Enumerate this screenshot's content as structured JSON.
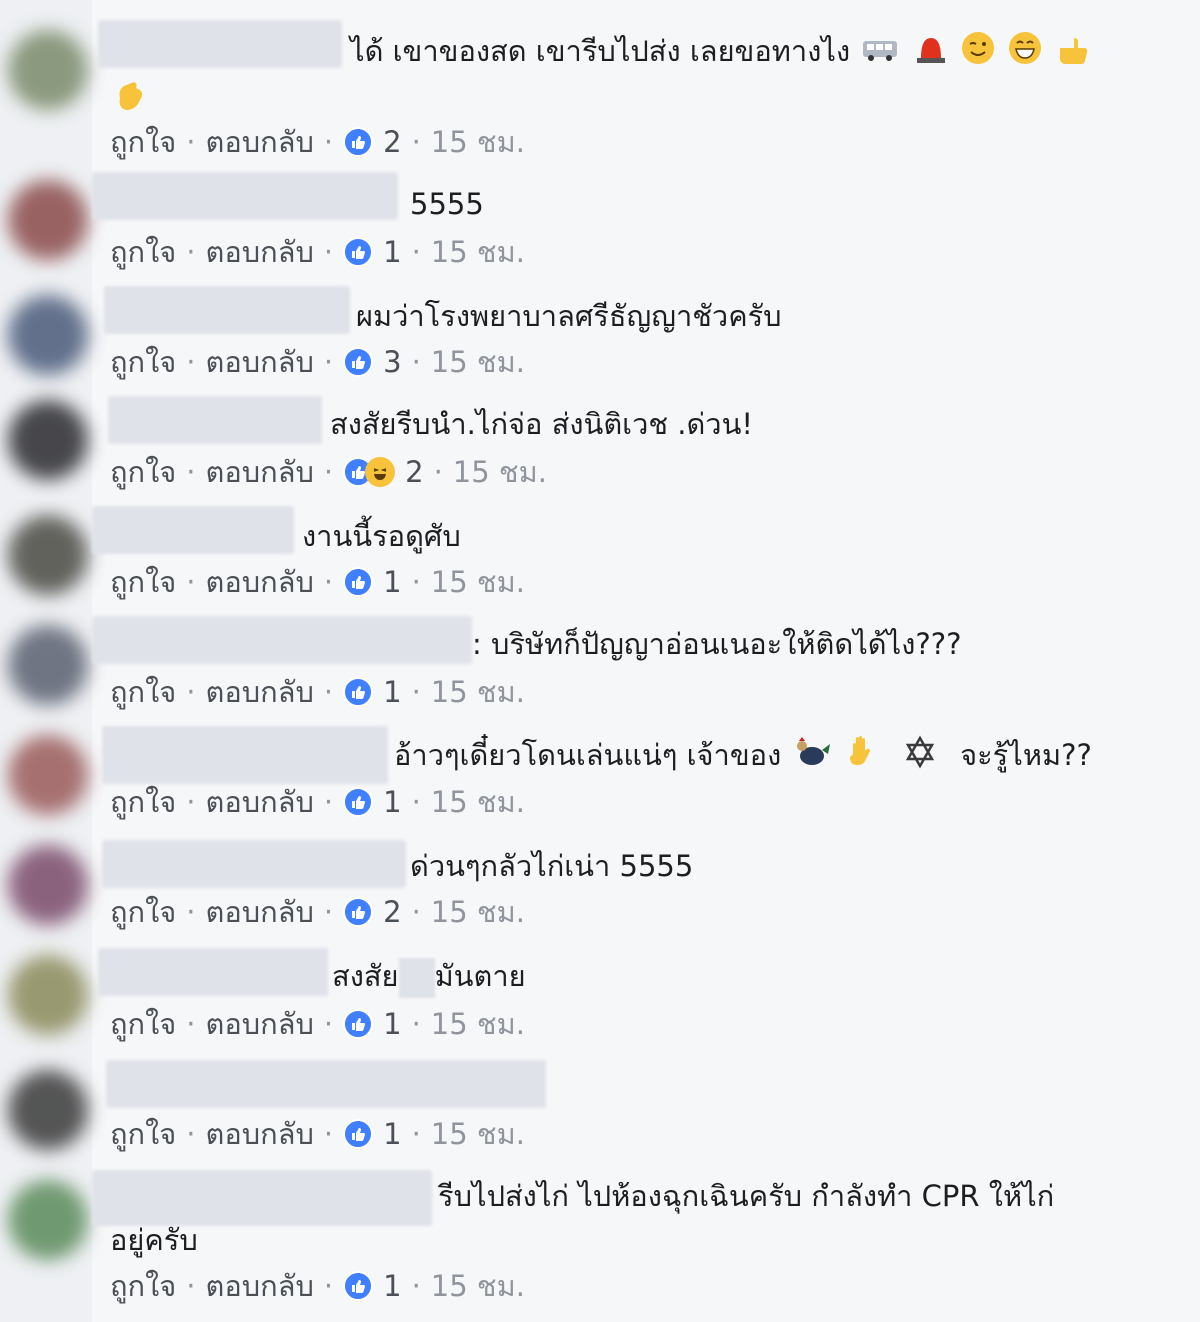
{
  "actions": {
    "like": "ถูกใจ",
    "reply": "ตอบกลับ",
    "sep": "·"
  },
  "colors": {
    "like_blue": "#4080ff",
    "link_grey": "#4b4f56",
    "meta_grey": "#90949c"
  },
  "comments": [
    {
      "text": "ได้ เขาของสด เขารีบไปส่ง เลยขอทางไง",
      "emojis": [
        "bus-icon",
        "siren-icon",
        "wink-emoji",
        "grin-emoji",
        "point-emoji"
      ],
      "text2": "",
      "reactions": [
        "like"
      ],
      "count": "2",
      "time": "15 ชม."
    },
    {
      "text": "5555",
      "reactions": [
        "like"
      ],
      "count": "1",
      "time": "15 ชม."
    },
    {
      "text": "ผมว่าโรงพยาบาลศรีธัญญาชัวครับ",
      "reactions": [
        "like"
      ],
      "count": "3",
      "time": "15 ชม."
    },
    {
      "text": "สงสัยรีบนำ.ไก่จ่อ ส่งนิติเวช .ด่วน!",
      "reactions": [
        "like",
        "haha"
      ],
      "count": "2",
      "time": "15 ชม."
    },
    {
      "text": "งานนี้รอดูศับ",
      "reactions": [
        "like"
      ],
      "count": "1",
      "time": "15 ชม."
    },
    {
      "text": ": บริษัทก็ปัญญาอ่อนเนอะให้ติดได้ไง???",
      "reactions": [
        "like"
      ],
      "count": "1",
      "time": "15 ชม."
    },
    {
      "text": "อ้าวๆเดี๋ยวโดนเล่นแน่ๆ เจ้าของ",
      "text_b": "จะรู้ไหม??",
      "reactions": [
        "like"
      ],
      "count": "1",
      "time": "15 ชม."
    },
    {
      "text": "ด่วนๆกลัวไก่เน่า 5555",
      "reactions": [
        "like"
      ],
      "count": "2",
      "time": "15 ชม."
    },
    {
      "text_a": "สงสัย",
      "text_b": "มันตาย",
      "reactions": [
        "like"
      ],
      "count": "1",
      "time": "15 ชม."
    },
    {
      "text": "",
      "reactions": [
        "like"
      ],
      "count": "1",
      "time": "15 ชม."
    },
    {
      "text": "รีบไปส่งไก่ ไปห้องฉุกเฉินครับ กำลังทำ CPR ให้ไก่",
      "text2": "อยู่ครับ",
      "reactions": [
        "like"
      ],
      "count": "1",
      "time": "15 ชม."
    }
  ]
}
